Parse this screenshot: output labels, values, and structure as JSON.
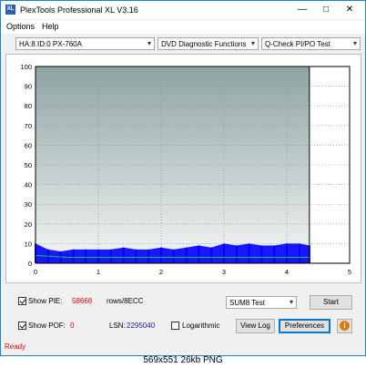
{
  "window": {
    "title": "PlexTools Professional XL V3.16",
    "app_icon_text": "XL",
    "controls": {
      "minimize": "—",
      "maximize": "□",
      "close": "✕"
    }
  },
  "menu": [
    {
      "label": "Options"
    },
    {
      "label": "Help"
    }
  ],
  "toolbar": {
    "drive": "HA:8 ID:0  PX-760A",
    "function": "DVD Diagnostic Functions",
    "test": "Q-Check PI/PO Test"
  },
  "chart_data": {
    "type": "line",
    "x_ticks": [
      "0",
      "1",
      "2",
      "3",
      "4",
      "5"
    ],
    "y_ticks": [
      "0",
      "10",
      "20",
      "30",
      "40",
      "50",
      "60",
      "70",
      "80",
      "90",
      "100"
    ],
    "xlim": [
      0,
      5
    ],
    "ylim": [
      0,
      100
    ],
    "x_end": 4.36,
    "marker_x": 4.36,
    "grid": true,
    "series": [
      {
        "type": "bar",
        "color": "#0000ff",
        "x": [
          0.0,
          0.2,
          0.4,
          0.6,
          0.8,
          1.0,
          1.2,
          1.4,
          1.6,
          1.8,
          2.0,
          2.2,
          2.4,
          2.6,
          2.8,
          3.0,
          3.2,
          3.4,
          3.6,
          3.8,
          4.0,
          4.2,
          4.36
        ],
        "values": [
          10,
          7,
          6,
          7,
          7,
          7,
          7,
          8,
          7,
          7,
          8,
          7,
          8,
          9,
          8,
          10,
          9,
          10,
          9,
          9,
          10,
          10,
          9
        ]
      },
      {
        "type": "line",
        "color": "#00cc33",
        "x": [
          0.0,
          0.5,
          1.0,
          1.5,
          2.0,
          2.5,
          3.0,
          3.5,
          4.0,
          4.36
        ],
        "values": [
          4,
          3,
          3,
          3,
          3,
          3,
          3,
          3,
          3,
          3
        ]
      }
    ]
  },
  "bottom": {
    "show_pie_label": "Show PIE:",
    "pie_value": "58668",
    "rows_label": "rows/8ECC",
    "show_pof_label": "Show POF:",
    "pof_value": "0",
    "lsn_label": "LSN:",
    "lsn_value": "2295040",
    "logarithmic_label": "Logarithmic",
    "test_select": "SUM8 Test",
    "start_button": "Start",
    "view_log_button": "View Log",
    "preferences_button": "Preferences",
    "info_icon": "i"
  },
  "status": "Ready",
  "caption": "569x551  26kb  PNG"
}
